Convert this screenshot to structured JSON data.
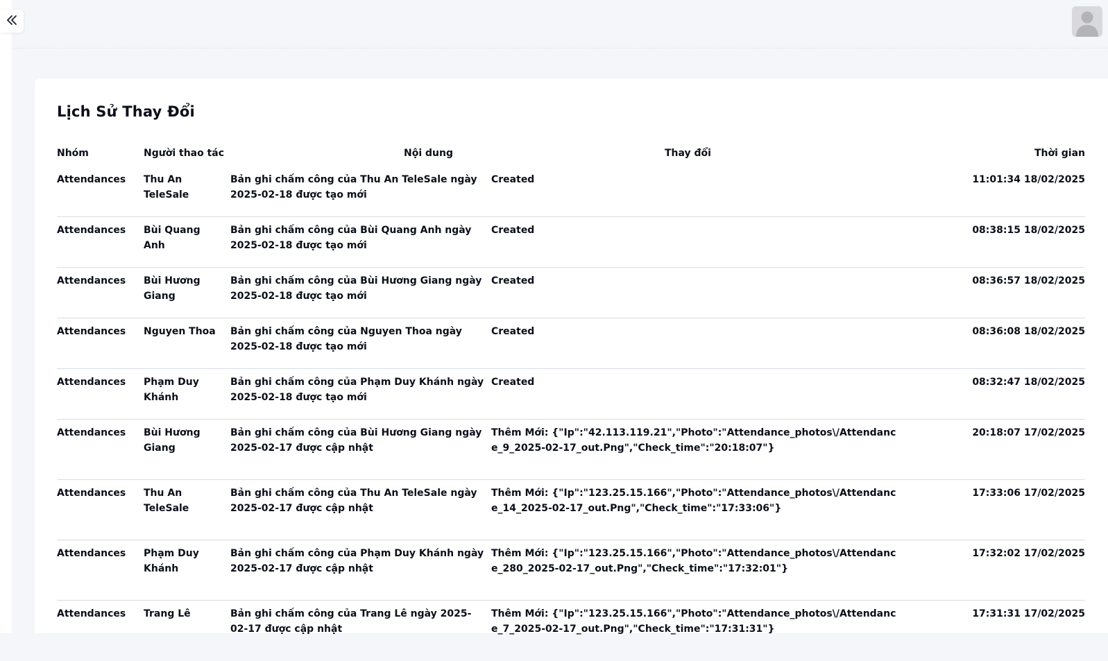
{
  "header": {
    "collapse_icon": "double-chevron-left-icon",
    "avatar_icon": "user-avatar-icon"
  },
  "page": {
    "title": "Lịch Sử Thay Đổi"
  },
  "table": {
    "columns": {
      "group": "Nhóm",
      "actor": "Người thao tác",
      "content": "Nội dung",
      "change": "Thay đổi",
      "time": "Thời gian"
    },
    "rows": [
      {
        "group": "Attendances",
        "actor": "Thu An TeleSale",
        "content": "Bản ghi chấm công của Thu An TeleSale ngày 2025-02-18 được tạo mới",
        "change": "Created",
        "time": "11:01:34 18/02/2025"
      },
      {
        "group": "Attendances",
        "actor": "Bùi Quang Anh",
        "content": "Bản ghi chấm công của Bùi Quang Anh ngày 2025-02-18 được tạo mới",
        "change": "Created",
        "time": "08:38:15 18/02/2025"
      },
      {
        "group": "Attendances",
        "actor": "Bùi Hương Giang",
        "content": "Bản ghi chấm công của Bùi Hương Giang ngày 2025-02-18 được tạo mới",
        "change": "Created",
        "time": "08:36:57 18/02/2025"
      },
      {
        "group": "Attendances",
        "actor": "Nguyen Thoa",
        "content": "Bản ghi chấm công của Nguyen Thoa ngày 2025-02-18 được tạo mới",
        "change": "Created",
        "time": "08:36:08 18/02/2025"
      },
      {
        "group": "Attendances",
        "actor": "Phạm Duy Khánh",
        "content": "Bản ghi chấm công của Phạm Duy Khánh ngày 2025-02-18 được tạo mới",
        "change": "Created",
        "time": "08:32:47 18/02/2025"
      },
      {
        "group": "Attendances",
        "actor": "Bùi Hương Giang",
        "content": "Bản ghi chấm công của Bùi Hương Giang ngày 2025-02-17 được cập nhật",
        "change": "Thêm Mới: {\"Ip\":\"42.113.119.21\",\"Photo\":\"Attendance_photos\\/Attendance_9_2025-02-17_out.Png\",\"Check_time\":\"20:18:07\"}",
        "time": "20:18:07 17/02/2025"
      },
      {
        "group": "Attendances",
        "actor": "Thu An TeleSale",
        "content": "Bản ghi chấm công của Thu An TeleSale ngày 2025-02-17 được cập nhật",
        "change": "Thêm Mới: {\"Ip\":\"123.25.15.166\",\"Photo\":\"Attendance_photos\\/Attendance_14_2025-02-17_out.Png\",\"Check_time\":\"17:33:06\"}",
        "time": "17:33:06 17/02/2025"
      },
      {
        "group": "Attendances",
        "actor": "Phạm Duy Khánh",
        "content": "Bản ghi chấm công của Phạm Duy Khánh ngày 2025-02-17 được cập nhật",
        "change": "Thêm Mới: {\"Ip\":\"123.25.15.166\",\"Photo\":\"Attendance_photos\\/Attendance_280_2025-02-17_out.Png\",\"Check_time\":\"17:32:01\"}",
        "time": "17:32:02 17/02/2025"
      },
      {
        "group": "Attendances",
        "actor": "Trang Lê",
        "content": "Bản ghi chấm công của Trang Lê ngày 2025-02-17 được cập nhật",
        "change": "Thêm Mới: {\"Ip\":\"123.25.15.166\",\"Photo\":\"Attendance_photos\\/Attendance_7_2025-02-17_out.Png\",\"Check_time\":\"17:31:31\"}",
        "time": "17:31:31 17/02/2025"
      }
    ]
  }
}
